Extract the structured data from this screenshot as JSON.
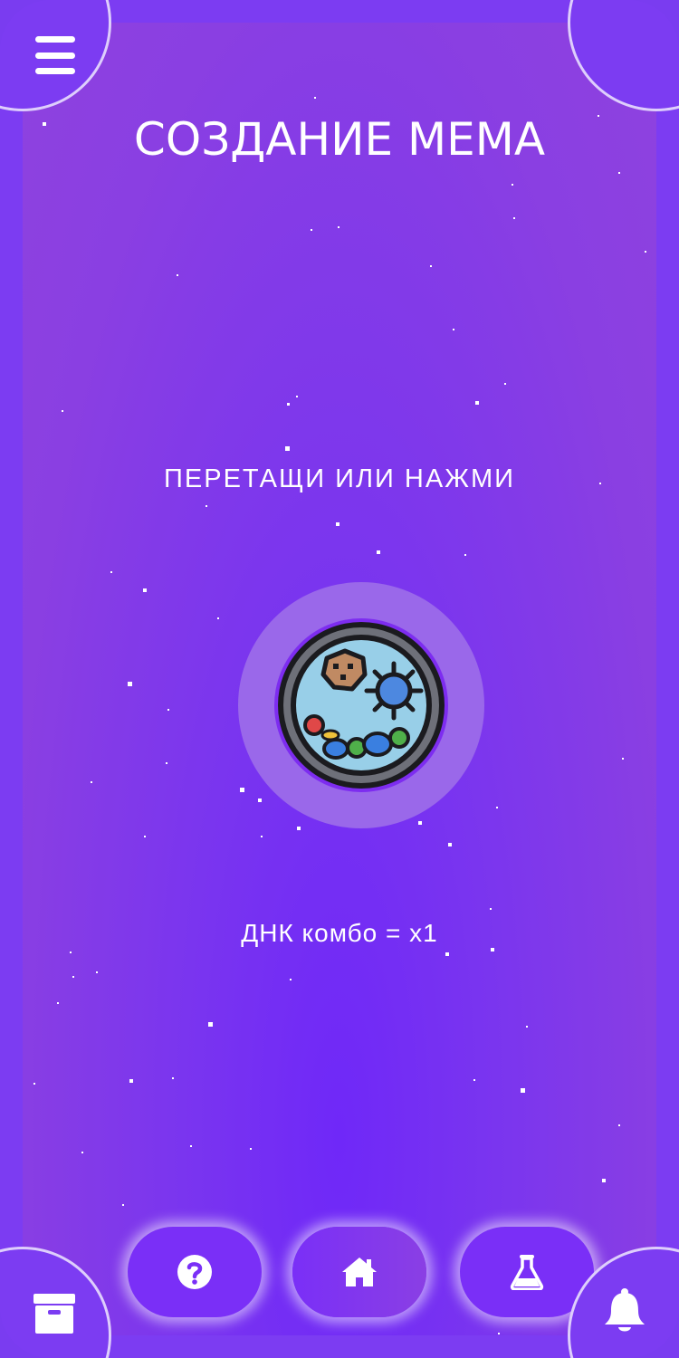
{
  "header": {
    "title": "СОЗДАНИЕ МЕМА",
    "menu_icon": "hamburger-menu-icon",
    "grid_icon": "grid-icon"
  },
  "main": {
    "hint": "ПЕРЕТАЩИ ИЛИ НАЖМИ",
    "meme_icon": "petri-dish-bacteria-icon",
    "combo": "ДНК комбо = x1"
  },
  "nav": {
    "help_icon": "question-circle-icon",
    "home_icon": "home-icon",
    "lab_icon": "flask-icon"
  },
  "corners": {
    "bottom_left_icon": "archive-box-icon",
    "bottom_right_icon": "bell-icon"
  },
  "colors": {
    "accent": "#7a2ff7",
    "background": "#8a3fe2",
    "text": "#ffffff"
  }
}
